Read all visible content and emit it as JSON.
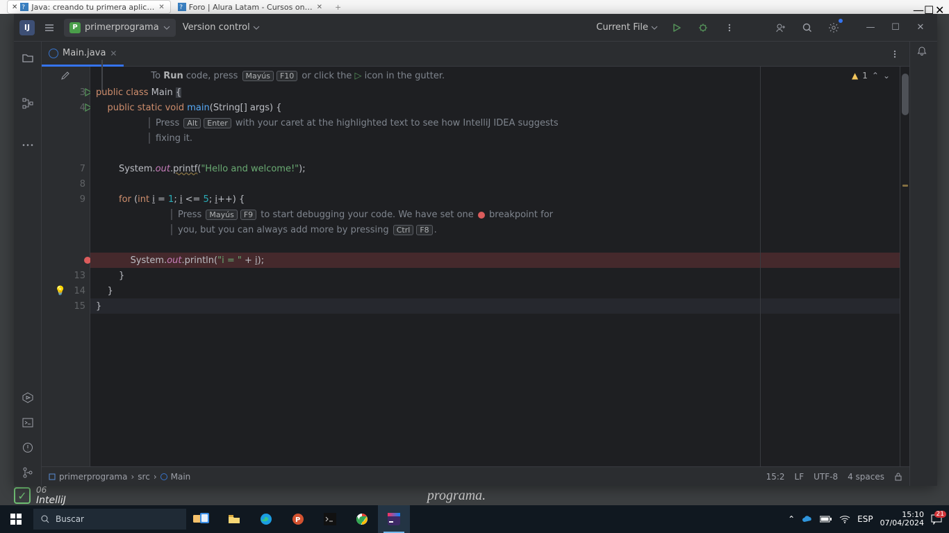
{
  "browser": {
    "tab1": "Java: creando tu primera aplic…",
    "tab2": "Foro | Alura Latam - Cursos on…"
  },
  "ide": {
    "project": "primerprograma",
    "version_control": "Version control",
    "run_selector": "Current File",
    "filetab": "Main.java",
    "analysis_count": "1",
    "hint_run_pre": "To ",
    "hint_run_strong": "Run",
    "hint_run_post": " code, press ",
    "hint_run_key1": "Mayús",
    "hint_run_key2": "F10",
    "hint_run_tail": " or click the ",
    "hint_run_tail2": " icon in the gutter.",
    "hint_fix_pre": "Press ",
    "hint_fix_k1": "Alt",
    "hint_fix_k2": "Enter",
    "hint_fix_mid": " with your caret at the highlighted text to see how IntelliJ IDEA suggests",
    "hint_fix_line2": "fixing it.",
    "hint_dbg_pre": "Press ",
    "hint_dbg_k1": "Mayús",
    "hint_dbg_k2": "F9",
    "hint_dbg_mid": " to start debugging your code. We have set one ",
    "hint_dbg_mid2": " breakpoint for",
    "hint_dbg_line2a": "you, but you can always add more by pressing ",
    "hint_dbg_k3": "Ctrl",
    "hint_dbg_k4": "F8",
    "code": {
      "l3": {
        "a": "public ",
        "b": "class ",
        "c": "Main ",
        "d": "{"
      },
      "l4": {
        "a": "    public static ",
        "b": "void ",
        "c": "main",
        "d": "(String[] args) {"
      },
      "l7": {
        "a": "        System.",
        "b": "out",
        "c": ".",
        "d": "printf",
        "e": "(",
        "f": "\"Hello and welcome!\"",
        "g": ");"
      },
      "l9": {
        "a": "        for ",
        "b": "(",
        "c": "int ",
        "d": "i",
        "e": " = ",
        "f": "1",
        "g": "; ",
        "h": "i",
        "i": " <= ",
        "j": "5",
        "k": "; ",
        "l": "i",
        "m": "++) {"
      },
      "l12": {
        "a": "            System.",
        "b": "out",
        "c": ".println(",
        "d": "\"i = \"",
        "e": " + ",
        "f": "i",
        "g": ");"
      },
      "l13": "        }",
      "l14": "    }",
      "l15": "}"
    },
    "gutter": {
      "n3": "3",
      "n4": "4",
      "n7": "7",
      "n8": "8",
      "n9": "9",
      "n13": "13",
      "n14": "14",
      "n15": "15"
    },
    "breadcrumbs": {
      "p1": "primerprograma",
      "p2": "src",
      "p3": "Main"
    },
    "status": {
      "pos": "15:2",
      "le": "LF",
      "enc": "UTF-8",
      "indent": "4 spaces"
    }
  },
  "backwin": {
    "left_text": "IntelliJ",
    "left_num": "06",
    "right_text": "programa."
  },
  "taskbar": {
    "search_ph": "Buscar",
    "lang": "ESP",
    "time": "15:10",
    "date": "07/04/2024",
    "notif": "21"
  }
}
